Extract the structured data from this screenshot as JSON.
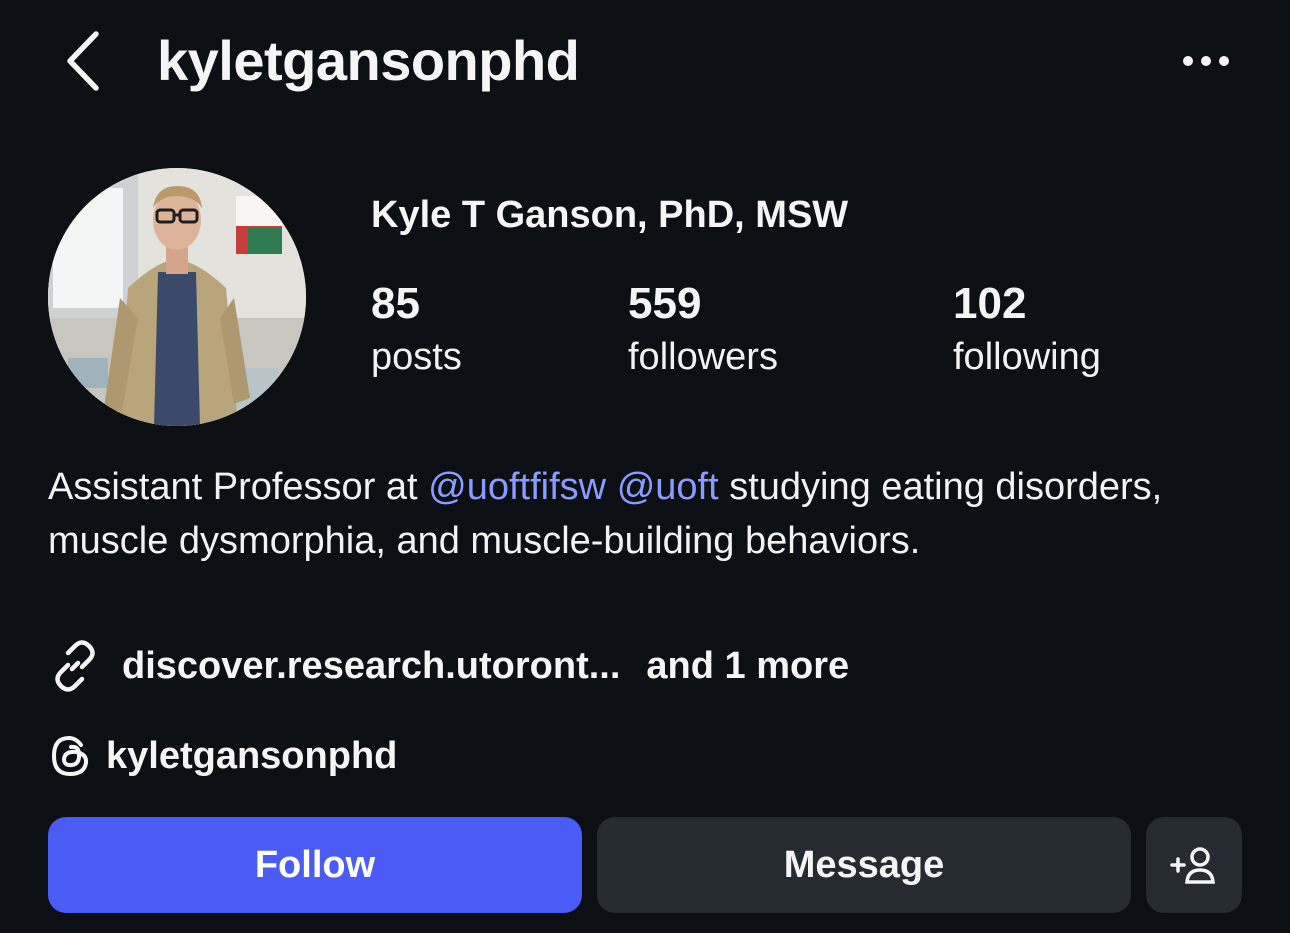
{
  "header": {
    "username": "kyletgansonphd",
    "back_icon": "chevron-left-icon",
    "more_icon": "more-horizontal-icon"
  },
  "profile": {
    "display_name": "Kyle T Ganson, PhD, MSW",
    "stats": {
      "posts": {
        "count": "85",
        "label": "posts"
      },
      "followers": {
        "count": "559",
        "label": "followers"
      },
      "following": {
        "count": "102",
        "label": "following"
      }
    },
    "bio": {
      "prefix": "Assistant Professor at ",
      "mention1": "@uoftfifsw",
      "space": " ",
      "mention2": "@uoft",
      "suffix": " studying eating disorders, muscle dysmorphia, and muscle-building behaviors."
    },
    "link": {
      "text": "discover.research.utoront...",
      "more": "and 1 more",
      "icon": "link-icon"
    },
    "threads": {
      "handle": "kyletgansonphd",
      "icon": "threads-icon"
    }
  },
  "actions": {
    "follow_label": "Follow",
    "message_label": "Message",
    "add_icon": "add-person-icon"
  },
  "colors": {
    "background": "#0c0f14",
    "accent": "#4a5cf5",
    "mention": "#8a9cff",
    "secondary_button": "#262a31"
  }
}
